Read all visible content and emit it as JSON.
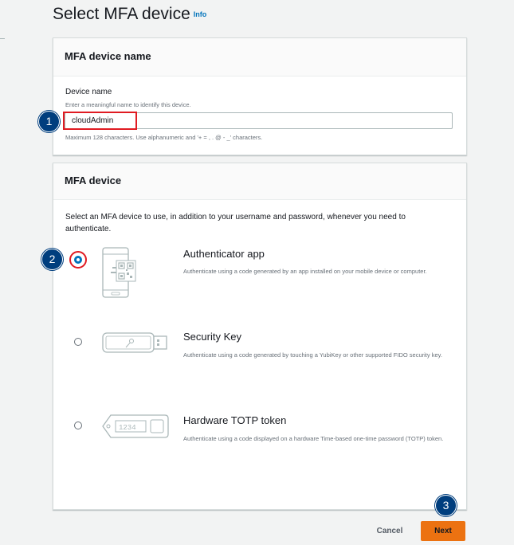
{
  "page": {
    "title": "Select MFA device",
    "info_link": "Info"
  },
  "name_section": {
    "header": "MFA device name",
    "label": "Device name",
    "description": "Enter a meaningful name to identify this device.",
    "value": "cloudAdmin",
    "constraint": "Maximum 128 characters. Use alphanumeric and '+ = , . @ - _' characters."
  },
  "device_section": {
    "header": "MFA device",
    "intro": "Select an MFA device to use, in addition to your username and password, whenever you need to authenticate.",
    "options": [
      {
        "title": "Authenticator app",
        "description": "Authenticate using a code generated by an app installed on your mobile device or computer.",
        "selected": true,
        "icon": "phone-qr-icon"
      },
      {
        "title": "Security Key",
        "description": "Authenticate using a code generated by touching a YubiKey or other supported FIDO security key.",
        "selected": false,
        "icon": "usb-key-icon"
      },
      {
        "title": "Hardware TOTP token",
        "description": "Authenticate using a code displayed on a hardware Time-based one-time password (TOTP) token.",
        "selected": false,
        "icon": "token-fob-icon",
        "token_text": "1234"
      }
    ]
  },
  "footer": {
    "cancel_label": "Cancel",
    "next_label": "Next"
  },
  "callouts": [
    "1",
    "2",
    "3"
  ],
  "colors": {
    "primary_button": "#ec7211",
    "link": "#0073bb",
    "callout": "#003e7e",
    "highlight": "#e01b22"
  }
}
